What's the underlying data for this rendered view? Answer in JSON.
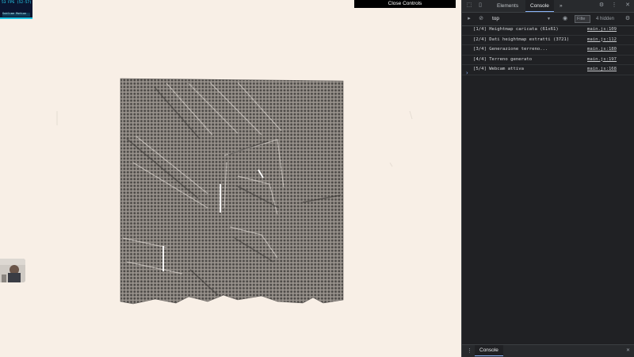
{
  "fps_panel": {
    "line1": "53 FPS (52-57)",
    "line2": "Sublime Motion"
  },
  "close_controls": "Close Controls",
  "devtools": {
    "tabs": [
      "Elements",
      "Console"
    ],
    "more": "»",
    "context": "top",
    "filter_placeholder": "Filte",
    "hidden": "4 hidden",
    "logs": [
      {
        "message": "[1/4] Heightmap caricata (61x61)",
        "source": "main.js:109"
      },
      {
        "message": "[2/4] Dati heightmap estratti (3721)",
        "source": "main.js:112"
      },
      {
        "message": "[3/4] Generazione terreno...",
        "source": "main.js:180"
      },
      {
        "message": "[4/4] Terreno generato",
        "source": "main.js:197"
      },
      {
        "message": "[5/4] Webcam attiva",
        "source": "main.js:168"
      }
    ],
    "drawer_tab": "Console"
  },
  "colors": {
    "background": "#f8efe6",
    "terrain": "#8a8580",
    "devtools_bg": "#202124",
    "accent": "#8ab4f8"
  }
}
